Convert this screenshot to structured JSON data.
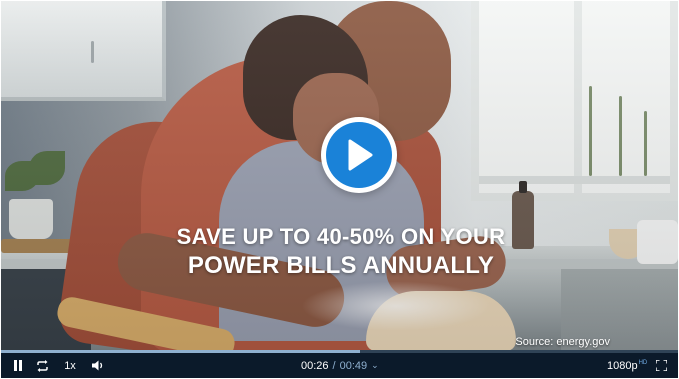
{
  "video": {
    "headline_line1": "SAVE UP TO 40-50% ON YOUR",
    "headline_line2": "POWER BILLS ANNUALLY",
    "source": "Source: energy.gov",
    "played_fraction": 0.53
  },
  "controls": {
    "speed": "1x",
    "current_time": "00:26",
    "separator": "/",
    "duration": "00:49",
    "quality": "1080p",
    "quality_badge": "HD"
  },
  "icons": {
    "overlay": "play-icon",
    "pause": "pause-icon",
    "loop": "loop-icon",
    "volume": "volume-icon",
    "fullscreen": "fullscreen-icon",
    "time_menu": "chevron-down-icon"
  },
  "colors": {
    "accent": "#1a82d8",
    "control_bar": "#0b1a2a",
    "progress_played": "#8fb0cf",
    "progress_track": "#2f4356"
  }
}
